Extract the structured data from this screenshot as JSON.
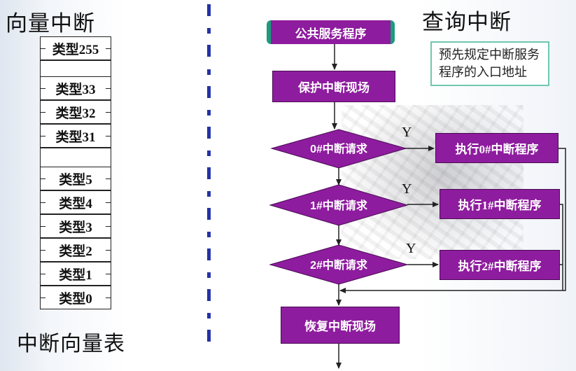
{
  "left": {
    "title": "向量中断",
    "caption": "中断向量表",
    "table": [
      "类型255",
      "类型33",
      "类型32",
      "类型31",
      "类型5",
      "类型4",
      "类型3",
      "类型2",
      "类型1",
      "类型0"
    ]
  },
  "right": {
    "title": "查询中断",
    "note": [
      "预先规定中断服务",
      "程序的入口地址"
    ],
    "start": "公共服务程序",
    "protect": "保护中断现场",
    "restore": "恢复中断现场",
    "requests": [
      "0#中断请求",
      "1#中断请求",
      "2#中断请求"
    ],
    "handlers": [
      "执行0#中断程序",
      "执行1#中断程序",
      "执行2#中断程序"
    ],
    "yes_label": "Y"
  }
}
